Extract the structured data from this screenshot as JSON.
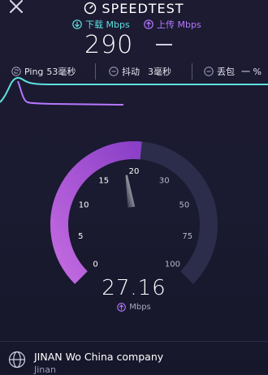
{
  "header": {
    "brand": "SPEEDTEST"
  },
  "download": {
    "label": "下载 Mbps",
    "value": "290",
    "color": "#5fe0e0"
  },
  "upload": {
    "label": "上传 Mbps",
    "value": "—",
    "color": "#b678ff"
  },
  "stats": {
    "ping": {
      "label": "Ping",
      "value": "53毫秒"
    },
    "jitter": {
      "label": "抖动",
      "value": "3毫秒"
    },
    "loss": {
      "label": "丢包",
      "value": "一 %"
    }
  },
  "gauge": {
    "ticks": [
      "0",
      "5",
      "10",
      "15",
      "20",
      "30",
      "50",
      "75",
      "100"
    ],
    "current_value": "27.16",
    "unit": "Mbps",
    "fill_fraction": 0.52,
    "accent": "#9b4dd1"
  },
  "isp": {
    "name": "JINAN Wo China company",
    "city": "Jinan"
  }
}
